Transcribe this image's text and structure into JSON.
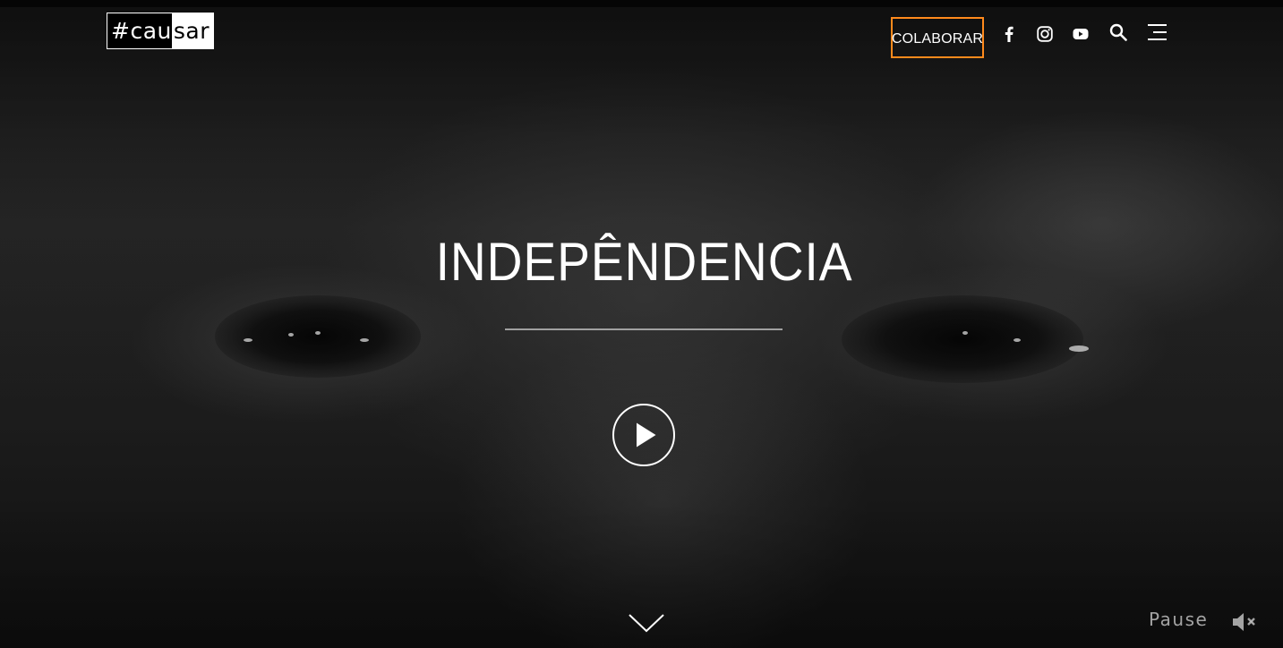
{
  "header": {
    "logo_left": "#cau",
    "logo_right": "sar",
    "cta_label": "COLABORAR",
    "accent_color": "#ff8a1c",
    "social_icons": [
      "facebook-icon",
      "instagram-icon",
      "youtube-icon"
    ],
    "utility_icons": [
      "search-icon",
      "menu-icon"
    ]
  },
  "hero": {
    "title": "INDEPÊNDENCIA",
    "play_icon": "play-icon",
    "scroll_icon": "chevron-down-icon"
  },
  "video_controls": {
    "pause_label": "Pause",
    "mute_icon": "mute-icon"
  }
}
